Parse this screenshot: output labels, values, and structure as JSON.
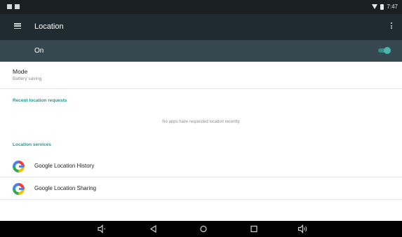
{
  "status_bar": {
    "time": "7:47"
  },
  "app_bar": {
    "title": "Location"
  },
  "master_switch": {
    "label": "On",
    "enabled": true,
    "accent": "#4db6ac"
  },
  "mode": {
    "title": "Mode",
    "summary": "Battery saving"
  },
  "recent_requests": {
    "header": "Recent location requests",
    "empty_message": "No apps have requested location recently"
  },
  "location_services": {
    "header": "Location services",
    "items": [
      {
        "label": "Google Location History",
        "icon": "google-g-icon"
      },
      {
        "label": "Google Location Sharing",
        "icon": "google-g-icon"
      }
    ]
  },
  "nav_bar": {
    "buttons": [
      "volume-down-icon",
      "back-icon",
      "home-icon",
      "recents-icon",
      "volume-up-icon"
    ]
  },
  "colors": {
    "toolbar": "#1f2b31",
    "switch_bar": "#37474f",
    "section_header": "#26978b"
  }
}
